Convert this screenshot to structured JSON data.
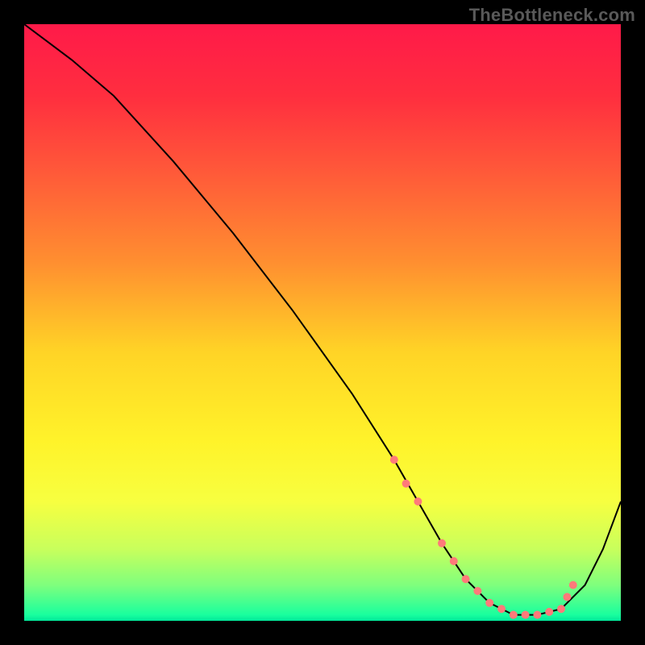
{
  "watermark": "TheBottleneck.com",
  "chart_data": {
    "type": "line",
    "title": "",
    "xlabel": "",
    "ylabel": "",
    "xlim": [
      0,
      100
    ],
    "ylim": [
      0,
      100
    ],
    "background_gradient": {
      "stops": [
        {
          "offset": 0.0,
          "color": "#ff1a49"
        },
        {
          "offset": 0.12,
          "color": "#ff2e3f"
        },
        {
          "offset": 0.25,
          "color": "#ff5a39"
        },
        {
          "offset": 0.4,
          "color": "#ff8f30"
        },
        {
          "offset": 0.55,
          "color": "#ffd426"
        },
        {
          "offset": 0.7,
          "color": "#fff32a"
        },
        {
          "offset": 0.8,
          "color": "#f7ff40"
        },
        {
          "offset": 0.88,
          "color": "#c8ff5c"
        },
        {
          "offset": 0.94,
          "color": "#7fff7d"
        },
        {
          "offset": 0.99,
          "color": "#19ff9e"
        },
        {
          "offset": 1.0,
          "color": "#00e79a"
        }
      ]
    },
    "series": [
      {
        "name": "bottleneck-curve",
        "color": "#000000",
        "stroke_width": 2,
        "x": [
          0,
          4,
          8,
          15,
          25,
          35,
          45,
          55,
          62,
          66,
          70,
          74,
          78,
          82,
          86,
          90,
          94,
          97,
          100
        ],
        "y": [
          100,
          97,
          94,
          88,
          77,
          65,
          52,
          38,
          27,
          20,
          13,
          7,
          3,
          1,
          1,
          2,
          6,
          12,
          20
        ]
      }
    ],
    "markers": {
      "name": "highlight-points",
      "color": "#ff7a7a",
      "radius": 5,
      "x": [
        62,
        64,
        66,
        70,
        72,
        74,
        76,
        78,
        80,
        82,
        84,
        86,
        88,
        90,
        91,
        92
      ],
      "y": [
        27,
        23,
        20,
        13,
        10,
        7,
        5,
        3,
        2,
        1,
        1,
        1,
        1.5,
        2,
        4,
        6
      ]
    }
  }
}
